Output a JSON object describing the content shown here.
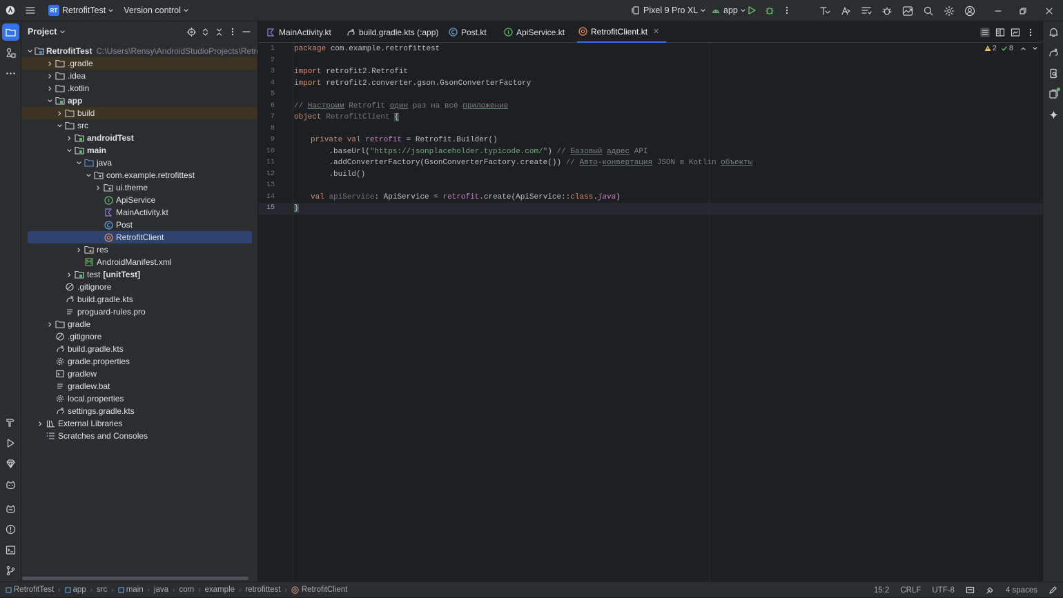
{
  "titlebar": {
    "project_badge": "RT",
    "project_name": "RetrofitTest",
    "vcs_label": "Version control",
    "device": "Pixel 9 Pro XL",
    "run_config": "app"
  },
  "project_panel": {
    "title": "Project",
    "root_name": "RetrofitTest",
    "root_path": "C:\\Users\\Rensy\\AndroidStudioProjects\\RetrofitTest",
    "items": [
      {
        "label": ".gradle"
      },
      {
        "label": ".idea"
      },
      {
        "label": ".kotlin"
      },
      {
        "label": "app"
      },
      {
        "label": "build"
      },
      {
        "label": "src"
      },
      {
        "label": "androidTest"
      },
      {
        "label": "main"
      },
      {
        "label": "java"
      },
      {
        "label": "com.example.retrofittest"
      },
      {
        "label": "ui.theme"
      },
      {
        "label": "ApiService"
      },
      {
        "label": "MainActivity.kt"
      },
      {
        "label": "Post"
      },
      {
        "label": "RetrofitClient"
      },
      {
        "label": "res"
      },
      {
        "label": "AndroidManifest.xml"
      },
      {
        "label": "test",
        "suffix": "[unitTest]"
      },
      {
        "label": ".gitignore"
      },
      {
        "label": "build.gradle.kts"
      },
      {
        "label": "proguard-rules.pro"
      },
      {
        "label": "gradle"
      },
      {
        "label": ".gitignore"
      },
      {
        "label": "build.gradle.kts"
      },
      {
        "label": "gradle.properties"
      },
      {
        "label": "gradlew"
      },
      {
        "label": "gradlew.bat"
      },
      {
        "label": "local.properties"
      },
      {
        "label": "settings.gradle.kts"
      },
      {
        "label": "External Libraries"
      },
      {
        "label": "Scratches and Consoles"
      }
    ]
  },
  "tabs": [
    {
      "label": "MainActivity.kt"
    },
    {
      "label": "build.gradle.kts (:app)"
    },
    {
      "label": "Post.kt"
    },
    {
      "label": "ApiService.kt"
    },
    {
      "label": "RetrofitClient.kt",
      "close": "✕"
    }
  ],
  "editor": {
    "warnings": "2",
    "checks": "8",
    "line_numbers": [
      "1",
      "2",
      "3",
      "4",
      "5",
      "6",
      "7",
      "8",
      "9",
      "10",
      "11",
      "12",
      "13",
      "14",
      "15"
    ],
    "code": {
      "l1_kw": "package",
      "l1_rest": " com.example.retrofittest",
      "l3_kw": "import",
      "l3_rest": " retrofit2.Retrofit",
      "l4_kw": "import",
      "l4_rest": " retrofit2.converter.gson.GsonConverterFactory",
      "l6_a": "// ",
      "l6_b": "Настроим",
      "l6_c": " Retrofit ",
      "l6_d": "один",
      "l6_e": " раз на всё ",
      "l6_f": "приложение",
      "l7_kw": "object",
      "l7_name": " RetrofitClient ",
      "l7_brace": "{",
      "l9_kw": "private val",
      "l9_name": " retrofit",
      "l9_rest": " = Retrofit.Builder()",
      "l10_a": "    .baseUrl(",
      "l10_str": "\"https://jsonplaceholder.typicode.com/\"",
      "l10_b": ") ",
      "l10_c": "// ",
      "l10_d": "Базовый",
      "l10_e": " ",
      "l10_f": "адрес",
      "l10_g": " API",
      "l11_a": "    .addConverterFactory(GsonConverterFactory.create()) ",
      "l11_c": "// ",
      "l11_d": "Авто",
      "l11_e": "-",
      "l11_f": "конвертация",
      "l11_g": " JSON в Kotlin ",
      "l11_h": "объекты",
      "l12": "    .build()",
      "l14_kw": "val",
      "l14_name": " apiService",
      "l14_a": ": ApiService = ",
      "l14_prop": "retrofit",
      "l14_b": ".create(ApiService::",
      "l14_kw2": "class",
      "l14_c": ".",
      "l14_java": "java",
      "l14_d": ")",
      "l15": "}"
    }
  },
  "statusbar": {
    "breadcrumb": [
      "RetrofitTest",
      "app",
      "src",
      "main",
      "java",
      "com",
      "example",
      "retrofittest",
      "RetrofitClient"
    ],
    "position": "15:2",
    "line_sep": "CRLF",
    "encoding": "UTF-8",
    "indent": "4 spaces"
  },
  "colors": {
    "accent": "#3574f0",
    "editor_bg": "#1e1f22",
    "panel_bg": "#2b2d30",
    "keyword": "#cf8e6d",
    "string": "#6aab73"
  }
}
